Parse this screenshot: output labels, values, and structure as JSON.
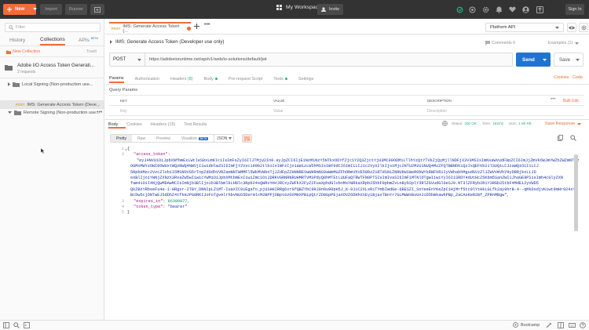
{
  "topbar": {
    "new_label": "New",
    "import_label": "Import",
    "runner_label": "Runner",
    "workspace_label": "My Workspace",
    "invite_label": "Invite",
    "signin_label": "Sign In"
  },
  "sidebar": {
    "filter_placeholder": "Filter",
    "tabs": {
      "history": "History",
      "collections": "Collections",
      "apis": "APIs",
      "apis_badge": "BETA"
    },
    "new_collection": "New Collection",
    "trash": "Trash",
    "collection": {
      "title": "Adobe I/O Access Token Generati...",
      "subtitle": "2 requests"
    },
    "folders": [
      "Local Signing (Non-production use...",
      "Remote Signing (Non-production use..."
    ],
    "request": {
      "method": "POST",
      "label": "IMS: Generate Access Token (Deve..."
    }
  },
  "request_tab": {
    "method": "POST",
    "label": "IMS: Generate Access Token (..."
  },
  "environment": "Platform API",
  "request": {
    "title": "IMS: Generate Access Token (Developer use only)",
    "comments": "Comments 0",
    "examples": "Examples (1)",
    "method": "POST",
    "url": "https://adobeioruntime.net/api/v1/web/io-solutions/default/jwt",
    "send_label": "Send",
    "save_label": "Save"
  },
  "request_tabs": {
    "params": "Params",
    "authorization": "Authorization",
    "headers": "Headers",
    "headers_count": "(8)",
    "body": "Body",
    "prerequest": "Pre-request Script",
    "tests": "Tests",
    "settings": "Settings",
    "cookies": "Cookies",
    "code": "Code"
  },
  "query_params": {
    "label": "Query Params",
    "headers": {
      "key": "KEY",
      "value": "VALUE",
      "description": "DESCRIPTION"
    },
    "placeholders": {
      "key": "Key",
      "value": "Value",
      "description": "Description"
    },
    "bulk_edit": "Bulk Edit"
  },
  "response_tabs": {
    "body": "Body",
    "cookies": "Cookies",
    "headers": "Headers (15)",
    "test_results": "Test Results"
  },
  "response_status": {
    "status_label": "Status:",
    "status_value": "200 OK",
    "time_label": "Time:",
    "time_value": "182ms",
    "size_label": "Size:",
    "size_value": "1.88 KB",
    "save_response": "Save Response"
  },
  "format": {
    "pretty": "Pretty",
    "raw": "Raw",
    "preview": "Preview",
    "visualize": "Visualize",
    "visualize_badge": "BETA",
    "type": "JSON"
  },
  "response_body": {
    "open": "{",
    "access_token_key": "\"access_token\":",
    "access_token_lines": [
      "\"eyJ4NVUiOiJpbXNfbmExLWtleS0xLmNlciIsImFsZyI6IlJTMjU2In0.eyJpZCI6IjE1NzM1NzY5NTkxODYfZjc1Y2Q3ZjctYjU3MC00ODM1LTlhYzQtYTVkZjQyMjllNDFjX3V3MSIsImNsaWVudF9pZCI6ImJjZmVkOWJmYWZhZWZmNTIzODQ1",
      "OGMxMWYzOWI0OWUxYWQzNWQ4NWVjIiwidHlwZSI6ImFjY2Vzc190b2tlbiIsImFzIjoiaW1zLW5hMSIsImF0dCI6ImIiLCJ1c2VyX2lkIjoiMjc2NTU2MzU1NUQ4MzZFQTBBNDk1QzIxQEFkb2JlSUQiLCJzaWQiOiIiLCJ",
      "5NpbHMzc2VzcZlvbiI6MSNOVG5rTnpZd0dhVVRZamNNTWMMFl5WkMVWbnTjJZdFpZZHNNREVwWHRmNS9aWmMUZFhORmVhVE50RzZ1RTdSNiZNRUbW1WeR0bWYkRWFkRiIyVWhabhMgudGVzZlJZWVVmVhYHyDRRjknLLJD",
      "eXBlIjoiYWNjZXNzX3RvaZW5wIiwicYWMiOiJpbXMtbmExIiwiZmciOiJDRKVGRNRNRUHMRTVMSPdyQ0hMTEtLUUFaQTRWTFN0PTSIsImIvaSI6ImF1MTNlOTgwIiwiYyI6IiSRDY4dUtHcZ5Kbm5SanZWIiJhaGE9PS1sImh4cGlyZXN",
      "fam4iOiI4NjQwMDAwMCIsImNjb3BlIjoib3BlbmlkLHNlc3Npb24sQWRvYmVJRCxyZWFkX2FyZ2FuaXphdGlvbnMsYWRkaXRpb25hbF9pbmZvLnByb2plY3RlZGVudGl0eSJ9.NT3lZFRyb2R1Y3RGb25tbF4MdEi2yVWD5"
    ],
    "access_token_tail": "QkZBXYRbseFu4e-1-HRgxr-2TBY_DNNIpLZ1MT-IuaXIC9iEgafo_pjUSHHIRRg6xrGfQBZYbC9RJ8n0u90pH5J_K-9JiC2XLsR1TYmbIwdGe-6BESZI_SnYeeEnYKeZpC1HjMrf5tc9lYtHkLGLfk2ay9hrB-4--qMkDsdjvKiwt9mHr924xYXBcDw5cjDNTwEJ5dDhZ4tfkHJPG8RKIJoFoTgvAlrhbvNUS5DermlcM2BPPjOBpt0zOXMHXPBipQtrZD8GpPEjaXOVZ6DHhXXEy1BjaxTBnYr7GLMWWxBvUnJiD5bmkawhPBp_ZaCAoKeR2Bf_ZPRnMBgw\",",
    "expires_in_key": "\"expires_in\":",
    "expires_in_value": "86399977,",
    "token_type_key": "\"token_type\":",
    "token_type_value": "\"bearer\"",
    "close": "}",
    "line_numbers": [
      "1",
      "2",
      "",
      "",
      "",
      "",
      "",
      "",
      "",
      "3",
      "4",
      "5"
    ]
  },
  "bottombar": {
    "bootcamp": "Bootcamp"
  },
  "colors": {
    "accent": "#f26b3a",
    "send_blue": "#1f74d1",
    "success_green": "#26b47f"
  }
}
